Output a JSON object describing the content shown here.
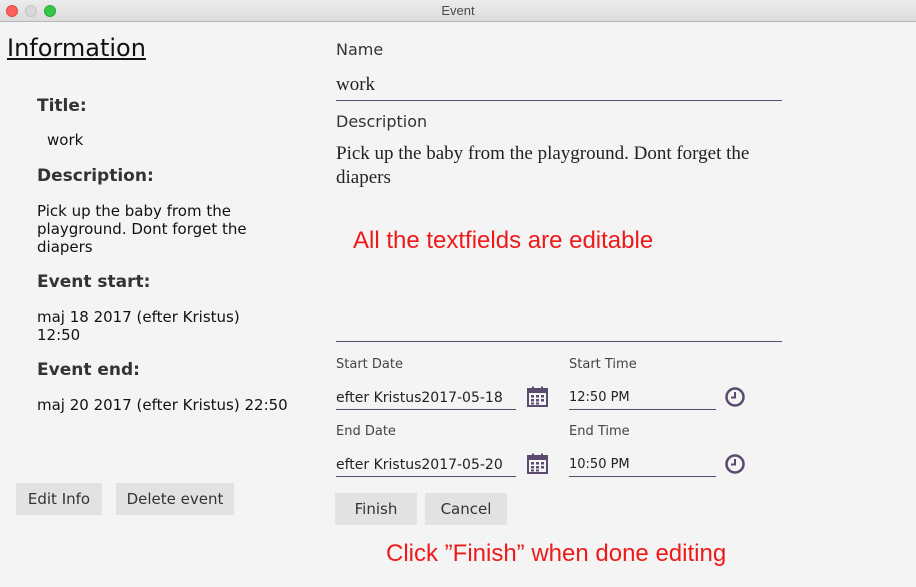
{
  "window": {
    "title": "Event"
  },
  "info": {
    "heading": "Information",
    "title_label": "Title:",
    "title_value": "work",
    "description_label": "Description:",
    "description_value": "Pick up the baby from the playground. Dont forget the diapers",
    "start_label": "Event start:",
    "start_value": "maj 18 2017 (efter Kristus) 12:50",
    "end_label": "Event end:",
    "end_value": "maj 20 2017 (efter Kristus)  22:50",
    "edit_button": "Edit Info",
    "delete_button": "Delete event"
  },
  "form": {
    "name_label": "Name",
    "name_value": "work",
    "description_label": "Description",
    "description_value": "Pick up the baby from the playground. Dont forget the diapers",
    "start_date_label": "Start Date",
    "start_date_value": "efter Kristus2017-05-18",
    "start_time_label": "Start Time",
    "start_time_value": "12:50 PM",
    "end_date_label": "End Date",
    "end_date_value": "efter Kristus2017-05-20",
    "end_time_label": "End Time",
    "end_time_value": "10:50 PM",
    "finish_button": "Finish",
    "cancel_button": "Cancel"
  },
  "annotations": {
    "editable_note": "All the textfields are editable",
    "finish_note": "Click ”Finish” when done editing"
  },
  "colors": {
    "accent": "#5a4a6e",
    "note": "#ee1a1a"
  },
  "icons": {
    "calendar": "calendar-icon",
    "clock": "clock-icon"
  }
}
